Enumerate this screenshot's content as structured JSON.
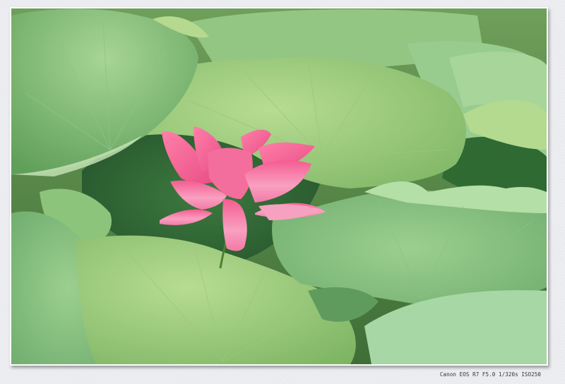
{
  "caption": "Canon EOS R7 F5.0 1/320s ISO250",
  "colors": {
    "page_background": "#e9eaee",
    "leaf_light": "#a8d18a",
    "leaf_mid": "#7fb86a",
    "leaf_dark": "#4c8a45",
    "lotus_pink": "#f26a9b"
  },
  "subject": "pink lotus flower among lotus leaves"
}
